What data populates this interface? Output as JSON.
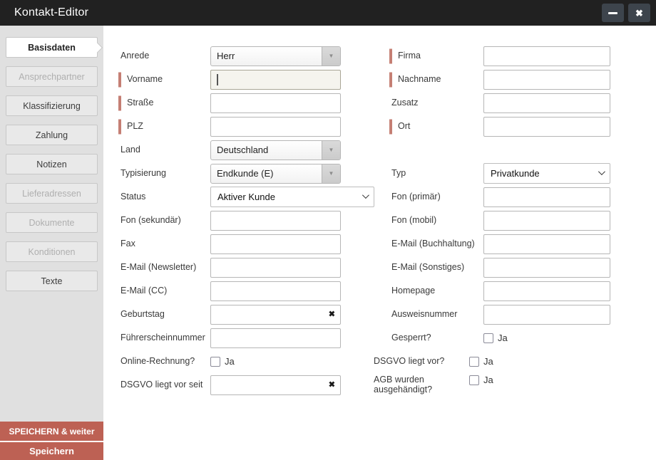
{
  "window": {
    "title": "Kontakt-Editor"
  },
  "glyphs": {
    "dropdown": "▼",
    "clear": "✖",
    "close": "✖"
  },
  "colors": {
    "titlebar": "#212121",
    "accent_red": "#bd6154",
    "required_bar": "#c57f74",
    "sidebar_bg": "#e0e0e0",
    "focused_input_bg": "#f5f4ee"
  },
  "sidebar": {
    "tabs": [
      {
        "label": "Basisdaten",
        "state": "active"
      },
      {
        "label": "Ansprechpartner",
        "state": "disabled"
      },
      {
        "label": "Klassifizierung",
        "state": "normal"
      },
      {
        "label": "Zahlung",
        "state": "normal"
      },
      {
        "label": "Notizen",
        "state": "normal"
      },
      {
        "label": "Lieferadressen",
        "state": "disabled"
      },
      {
        "label": "Dokumente",
        "state": "disabled"
      },
      {
        "label": "Konditionen",
        "state": "disabled"
      },
      {
        "label": "Texte",
        "state": "normal"
      }
    ],
    "save_and_next_label": "SPEICHERN & weiter",
    "save_label": "Speichern"
  },
  "form": {
    "left": [
      {
        "label": "Anrede",
        "type": "select-styled",
        "value": "Herr"
      },
      {
        "label": "Vorname",
        "type": "text",
        "value": "",
        "required": true,
        "focused": true
      },
      {
        "label": "Straße",
        "type": "text",
        "value": "",
        "required": true
      },
      {
        "label": "PLZ",
        "type": "text",
        "value": "",
        "required": true
      },
      {
        "label": "Land",
        "type": "select-styled",
        "value": "Deutschland"
      },
      {
        "label": "Typisierung",
        "type": "select-styled",
        "value": "Endkunde (E)"
      },
      {
        "label": "Status",
        "type": "select-native",
        "value": "Aktiver Kunde"
      },
      {
        "label": "Fon (sekundär)",
        "type": "text",
        "value": ""
      },
      {
        "label": "Fax",
        "type": "text",
        "value": ""
      },
      {
        "label": "E-Mail (Newsletter)",
        "type": "text",
        "value": ""
      },
      {
        "label": "E-Mail (CC)",
        "type": "text",
        "value": ""
      },
      {
        "label": "Geburtstag",
        "type": "text-clearable",
        "value": ""
      },
      {
        "label": "Führerscheinnummer",
        "type": "text",
        "value": ""
      },
      {
        "label": "Online-Rechnung?",
        "type": "checkbox",
        "checkbox_label": "Ja",
        "checked": false
      },
      {
        "label": "DSGVO liegt vor seit",
        "type": "text-clearable",
        "value": ""
      }
    ],
    "right": [
      {
        "label": "Firma",
        "type": "text",
        "value": "",
        "required": true
      },
      {
        "label": "Nachname",
        "type": "text",
        "value": "",
        "required": true
      },
      {
        "label": "Zusatz",
        "type": "text",
        "value": ""
      },
      {
        "label": "Ort",
        "type": "text",
        "value": "",
        "required": true
      },
      {
        "label": "Typ",
        "type": "select-native",
        "value": "Privatkunde"
      },
      {
        "label": "Fon (primär)",
        "type": "text",
        "value": ""
      },
      {
        "label": "Fon (mobil)",
        "type": "text",
        "value": ""
      },
      {
        "label": "E-Mail (Buchhaltung)",
        "type": "text",
        "value": ""
      },
      {
        "label": "E-Mail (Sonstiges)",
        "type": "text",
        "value": ""
      },
      {
        "label": "Homepage",
        "type": "text",
        "value": ""
      },
      {
        "label": "Ausweisnummer",
        "type": "text",
        "value": ""
      },
      {
        "label": "Gesperrt?",
        "type": "checkbox",
        "checkbox_label": "Ja",
        "checked": false
      },
      {
        "label": "DSGVO liegt vor?",
        "type": "checkbox",
        "checkbox_label": "Ja",
        "checked": false
      },
      {
        "label": "AGB wurden ausgehändigt?",
        "type": "checkbox",
        "checkbox_label": "Ja",
        "checked": false
      }
    ]
  }
}
